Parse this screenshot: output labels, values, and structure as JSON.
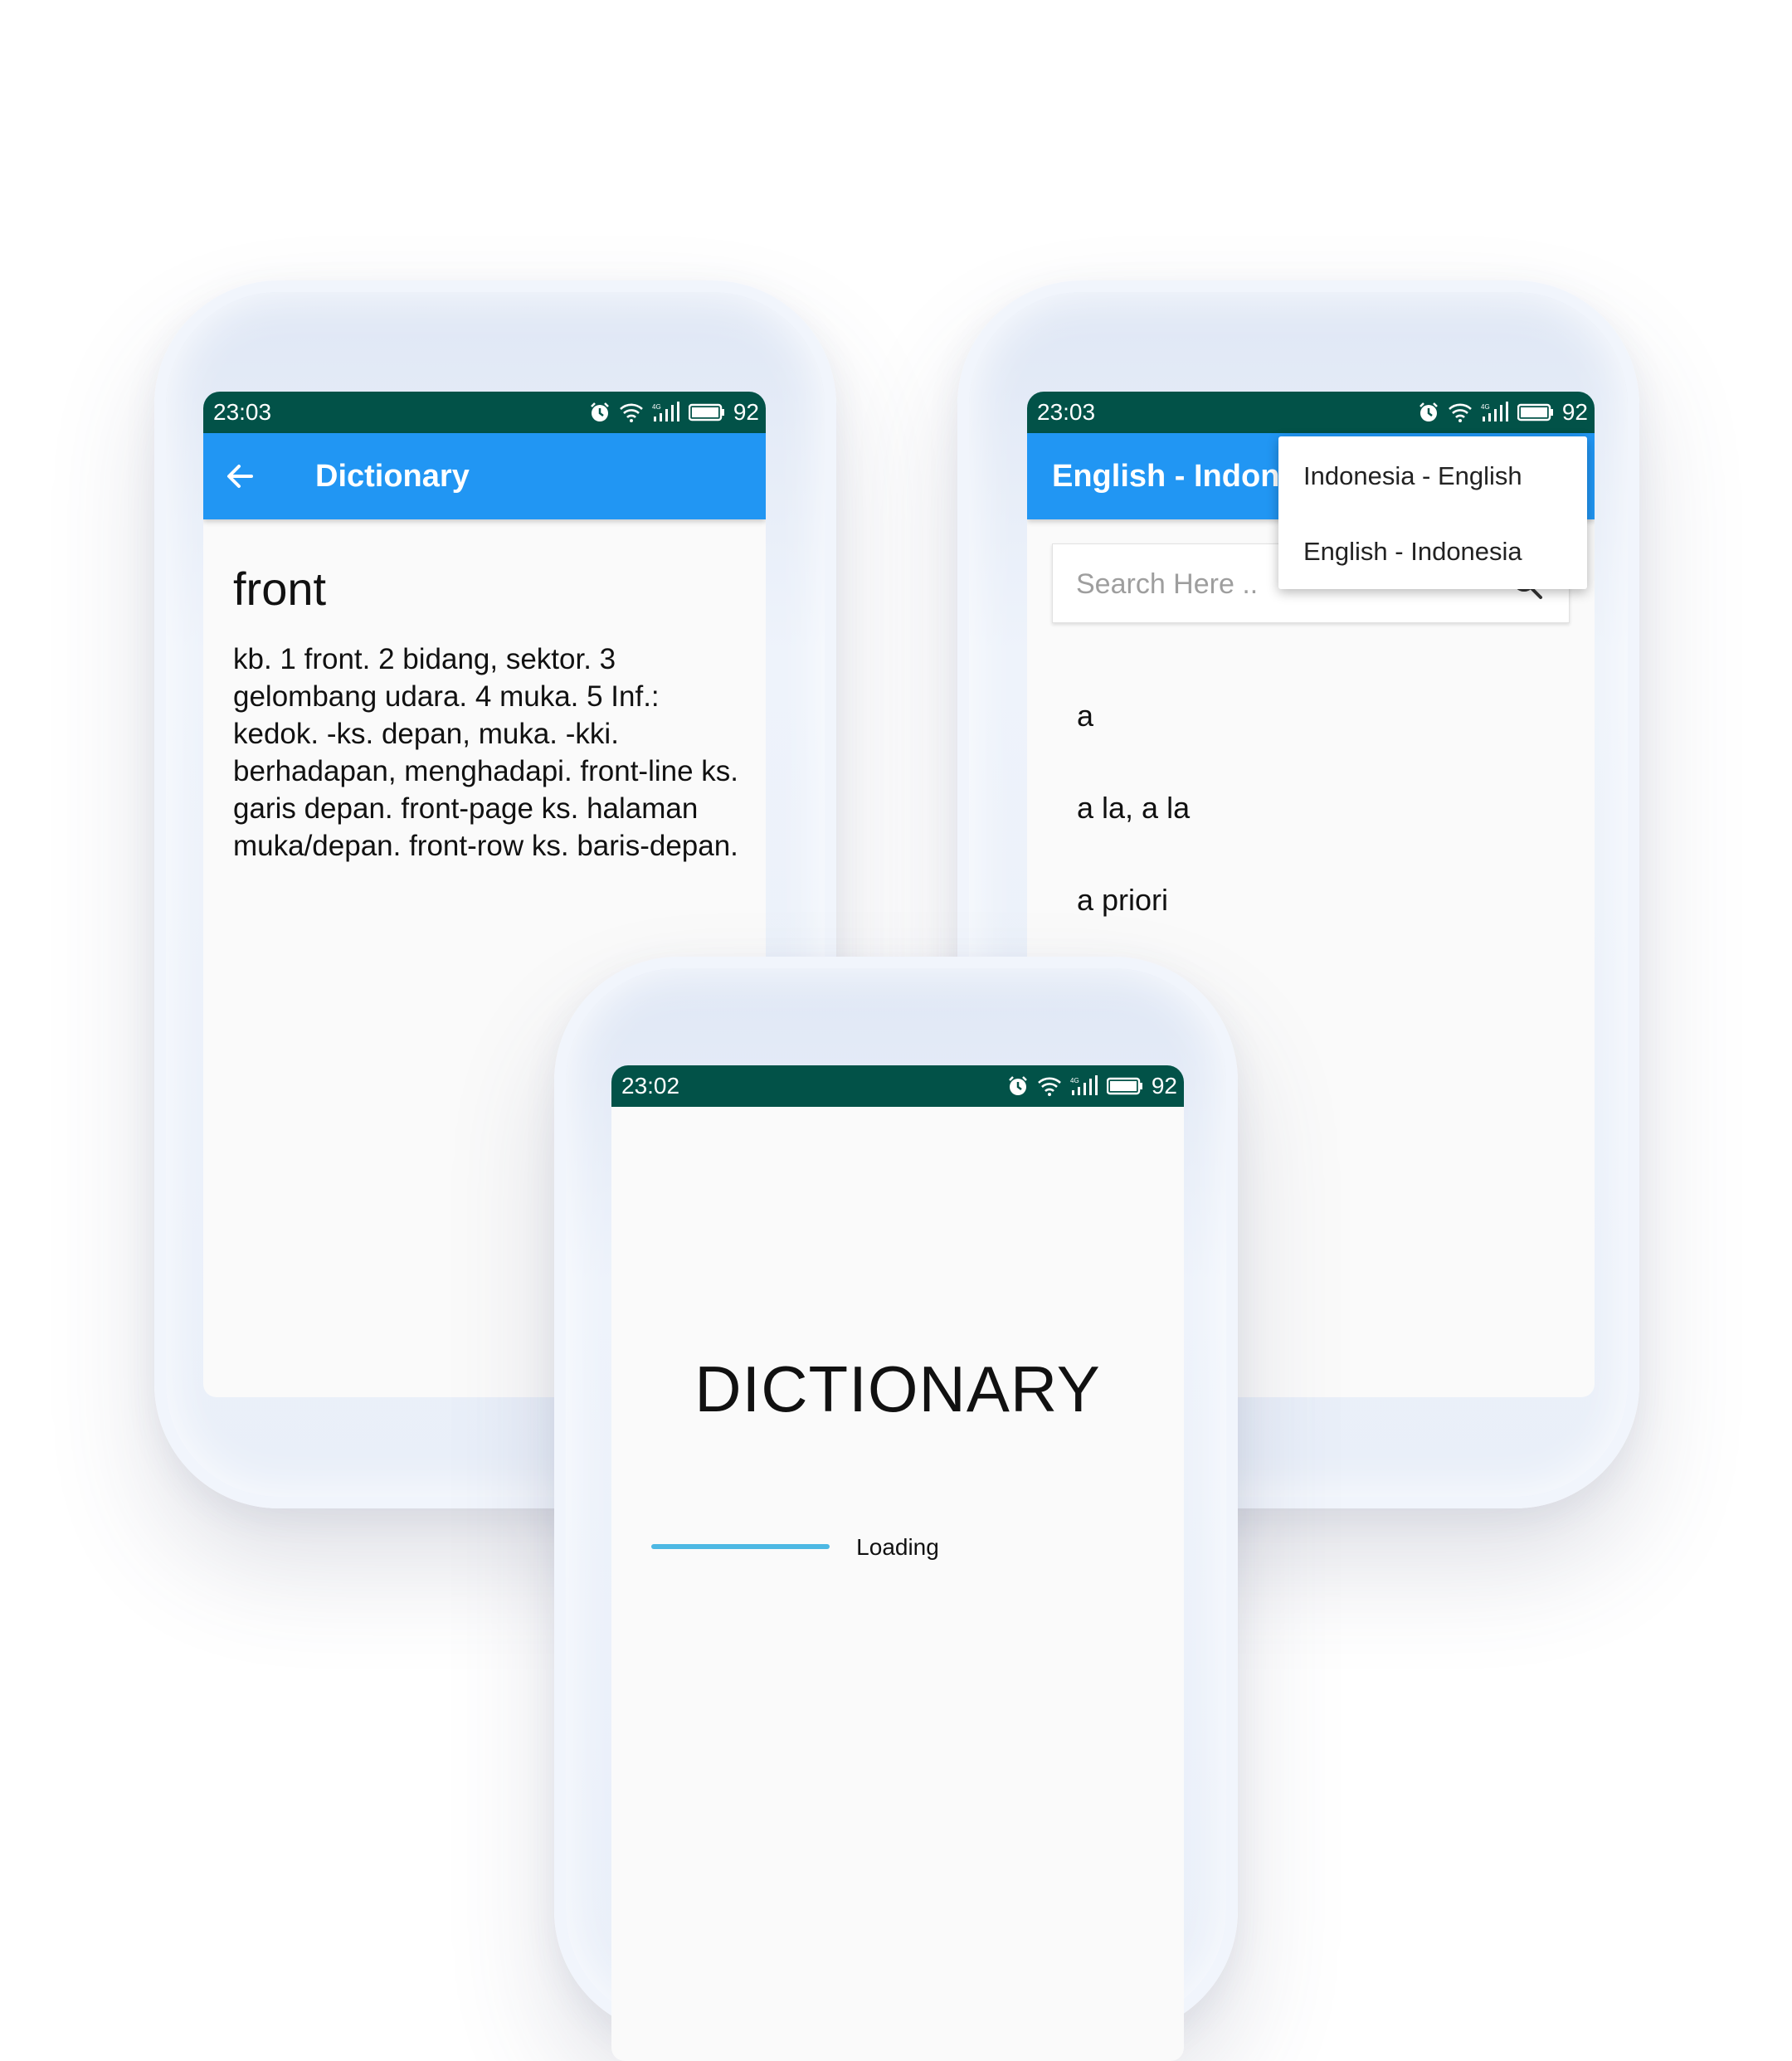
{
  "phones": {
    "detail": {
      "status": {
        "time": "23:03",
        "battery": "92"
      },
      "appbar": {
        "title": "Dictionary"
      },
      "word": "front",
      "definition": "kb. 1 front. 2 bidang, sektor. 3 gelombang udara. 4 muka. 5 Inf.: kedok. -ks. depan, muka. -kki. berhadapan, menghadapi. front-line ks. garis depan.  front-page ks. halaman muka/depan. front-row ks. baris-depan."
    },
    "list": {
      "status": {
        "time": "23:03",
        "battery": "92"
      },
      "appbar": {
        "title": "English - Indone"
      },
      "search": {
        "placeholder": "Search Here .."
      },
      "dropdown": {
        "options": [
          "Indonesia - English",
          "English - Indonesia"
        ]
      },
      "words": [
        "a",
        "a la, a la",
        "a priori"
      ]
    },
    "splash": {
      "status": {
        "time": "23:02",
        "battery": "92"
      },
      "title": "DICTIONARY",
      "loading_label": "Loading",
      "progress": 0.36,
      "progress_color": "#4db8e3"
    }
  },
  "colors": {
    "statusbar": "#025248",
    "appbar": "#2196f3",
    "screen": "#fafafa"
  },
  "icons": [
    "back-arrow-icon",
    "search-icon",
    "alarm-icon",
    "wifi-icon",
    "signal-icon",
    "battery-icon"
  ]
}
